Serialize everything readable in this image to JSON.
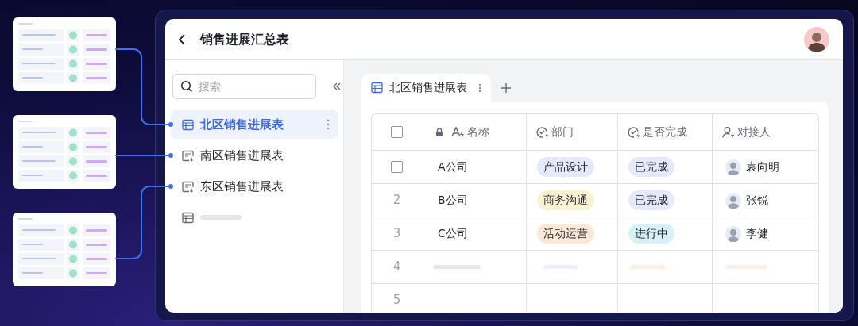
{
  "header": {
    "title": "销售进展汇总表"
  },
  "sidebar": {
    "search": {
      "placeholder": "搜索"
    },
    "items": [
      {
        "kind": "table",
        "label": "北区销售进展表",
        "selected": true
      },
      {
        "kind": "form",
        "label": "南区销售进展表",
        "selected": false
      },
      {
        "kind": "form",
        "label": "东区销售进展表",
        "selected": false
      },
      {
        "kind": "skeleton",
        "selected": false
      }
    ]
  },
  "tabs": [
    {
      "label": "北区销售进展表",
      "selected": true
    }
  ],
  "table": {
    "header_checkbox": {
      "checked": false
    },
    "columns": [
      {
        "kind": "text",
        "label": "名称",
        "locked": true
      },
      {
        "kind": "select",
        "label": "部门",
        "locked": false
      },
      {
        "kind": "select",
        "label": "是否完成",
        "locked": false
      },
      {
        "kind": "person",
        "label": "对接人",
        "locked": false
      }
    ],
    "rows": [
      {
        "kind": "filled",
        "checkbox": {
          "checked": false
        },
        "name": "A公司",
        "department": {
          "label": "产品设计",
          "color": "#e4e9fb"
        },
        "status": {
          "label": "已完成",
          "color": "#e4e9fb"
        },
        "contact": "袁向明"
      },
      {
        "kind": "filled",
        "number": "2",
        "name": "B公司",
        "department": {
          "label": "商务沟通",
          "color": "#fbf2d4"
        },
        "status": {
          "label": "已完成",
          "color": "#e4e9fb"
        },
        "contact": "张锐"
      },
      {
        "kind": "filled",
        "number": "3",
        "name": "C公司",
        "department": {
          "label": "活动运营",
          "color": "#fbe8d6"
        },
        "status": {
          "label": "进行中",
          "color": "#d8f1f8"
        },
        "contact": "李健"
      },
      {
        "kind": "skeleton",
        "number": "4"
      },
      {
        "kind": "empty",
        "number": "5"
      }
    ]
  }
}
